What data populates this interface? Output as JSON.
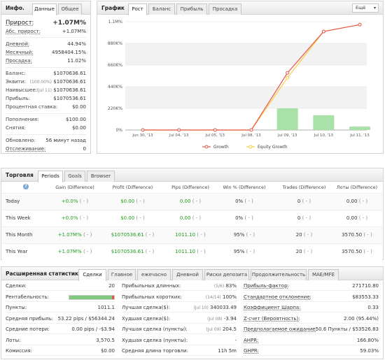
{
  "info": {
    "title": "Инфо.",
    "tabs": [
      "Данные",
      "Общее"
    ],
    "growth_label": "Прирост:",
    "growth_value": "+1.07M%",
    "abs_growth_label": "Абс. прирост:",
    "abs_growth_value": "+1.07M%",
    "rows1": [
      {
        "label": "Дневной:",
        "value": "44.94%"
      },
      {
        "label": "Месячный:",
        "value": "4958404.15%"
      },
      {
        "label": "Просадка:",
        "value": "11.02%"
      }
    ],
    "balance_label": "Баланс:",
    "balance_value": "$1070636.61",
    "equity_label": "Эквити:",
    "equity_note": "(100.00%)",
    "equity_value": "$1070636.61",
    "highest_label": "Наивысшее:",
    "highest_note": "(Jul 11)",
    "highest_value": "$1070636.61",
    "profit_label": "Прибыль:",
    "profit_value": "$1070536.61",
    "interest_label": "Процентная ставка:",
    "interest_value": "$0.00",
    "deposits_label": "Пополнения:",
    "deposits_value": "$100.00",
    "withdrawals_label": "Снятия:",
    "withdrawals_value": "$0.00",
    "updated_label": "Обновлено:",
    "updated_value": "56 минут назад",
    "tracking_label": "Отслеживание:",
    "tracking_value": "0"
  },
  "graph": {
    "title": "График",
    "tabs": [
      "Рост",
      "Баланс",
      "Прибыль",
      "Просадка"
    ],
    "more_label": "Ещё",
    "more_icon": "chevron-down-icon",
    "legend_growth": "Growth",
    "legend_equity": "Equity Growth",
    "colors": {
      "growth": "#e8564d",
      "equity": "#f5d142",
      "bars": "#a8e2a8",
      "grid": "#f2f2f2"
    }
  },
  "chart_data": {
    "type": "line",
    "categories": [
      "Jun 30, '13",
      "Jul 04, '13",
      "Jul 05, '13",
      "Jul 08, '13",
      "Jul 09, '13",
      "Jul 10, '13",
      "Jul 11, '13"
    ],
    "y_ticks": [
      "0%",
      "220K%",
      "440K%",
      "660K%",
      "880K%",
      "1.1M%"
    ],
    "ylim": [
      0,
      1100000
    ],
    "series": [
      {
        "name": "Growth",
        "values": [
          0,
          0,
          0,
          0,
          580000,
          1000000,
          1070000
        ]
      },
      {
        "name": "Equity Growth",
        "values": [
          0,
          0,
          0,
          0,
          530000,
          1000000,
          1070000
        ]
      }
    ],
    "bars": [
      0,
      0,
      0,
      0,
      220000,
      150000,
      35000
    ],
    "grid": true,
    "legend": "bottom"
  },
  "trading": {
    "title": "Торговля",
    "tabs": [
      "Periods",
      "Goals",
      "Browser"
    ],
    "help_icon": "question-icon",
    "headers": [
      "Gain (Difference)",
      "Profit (Difference)",
      "Pips (Difference)",
      "Win % (Difference)",
      "Trades (Difference)",
      "Лоты (Difference)"
    ],
    "rows": [
      {
        "period": "Today",
        "gain": "+0.0%",
        "gain_diff": "( - )",
        "profit": "$0.00",
        "profit_diff": "( - )",
        "pips": "0.00",
        "pips_diff": "( - )",
        "win": "0%",
        "win_diff": "( - )",
        "trades": "0",
        "trades_diff": "( - )",
        "lots": "0.00",
        "lots_diff": "( - )"
      },
      {
        "period": "This Week",
        "gain": "+0.0%",
        "gain_diff": "( - )",
        "profit": "$0.00",
        "profit_diff": "( - )",
        "pips": "0.00",
        "pips_diff": "( - )",
        "win": "0%",
        "win_diff": "( - )",
        "trades": "0",
        "trades_diff": "( - )",
        "lots": "0.00",
        "lots_diff": "( - )"
      },
      {
        "period": "This Month",
        "gain": "+1.07M%",
        "gain_diff": "( - )",
        "profit": "$1070536.61",
        "profit_diff": "( - )",
        "pips": "1011.10",
        "pips_diff": "( - )",
        "win": "95%",
        "win_diff": "( - )",
        "trades": "20",
        "trades_diff": "( - )",
        "lots": "3570.50",
        "lots_diff": "( - )"
      },
      {
        "period": "This Year",
        "gain": "+1.07M%",
        "gain_diff": "( - )",
        "profit": "$1070536.61",
        "profit_diff": "( - )",
        "pips": "1011.10",
        "pips_diff": "( - )",
        "win": "95%",
        "win_diff": "( - )",
        "trades": "20",
        "trades_diff": "( - )",
        "lots": "3570.50",
        "lots_diff": "( - )"
      }
    ]
  },
  "stats": {
    "title": "Расширенная статистика",
    "tabs": [
      "Сделки",
      "Главное",
      "ежечасно",
      "Дневной",
      "Риски депозита",
      "Продолжительность",
      "MAE/MFE"
    ],
    "col1": [
      {
        "label": "Сделки:",
        "value": "20"
      },
      {
        "label": "Рентабельность:",
        "value": ""
      },
      {
        "label": "Пункты:",
        "value": "1011.1"
      },
      {
        "label": "Средняя прибыль:",
        "value": "53.22 pips / $56344.24"
      },
      {
        "label": "Средние потери:",
        "value": "0.00 pips / -$3.94"
      },
      {
        "label": "Лоты:",
        "value": "3,570.5"
      },
      {
        "label": "Комиссия:",
        "value": "$0.00"
      }
    ],
    "profitability_fraction": 0.95,
    "col2": [
      {
        "label": "Прибыльных длинных:",
        "note": "(5/6)",
        "value": "83%"
      },
      {
        "label": "Прибыльных коротких:",
        "note": "(14/14)",
        "value": "100%"
      },
      {
        "label": "Лучшая сделка($):",
        "note": "(Jul 10)",
        "value": "340033.49"
      },
      {
        "label": "Худшая сделка($):",
        "note": "(Jul 08)",
        "value": "-3.94"
      },
      {
        "label": "Лучшая сделка (пункты):",
        "note": "(Jul 09)",
        "value": "204.5"
      },
      {
        "label": "Худшая сделка (пункты):",
        "note": "",
        "value": "-"
      },
      {
        "label": "Средняя длина торговли:",
        "note": "",
        "value": "11h 5m"
      }
    ],
    "col3": [
      {
        "label": "Прибыль-фактор:",
        "value": "271710.80"
      },
      {
        "label": "Стандартное отклонение:",
        "value": "$83553.33"
      },
      {
        "label": "Коэффициент Шарпа:",
        "value": "0.33"
      },
      {
        "label": "Z-счет (Вероятность):",
        "value": "2.00 (95.44%)"
      },
      {
        "label": "Предполагаемое ожидание:",
        "value": "50.6 Пункты / $53526.83"
      },
      {
        "label": "AHPR:",
        "value": "166.80%"
      },
      {
        "label": "GHPR:",
        "value": "59.03%"
      }
    ]
  }
}
